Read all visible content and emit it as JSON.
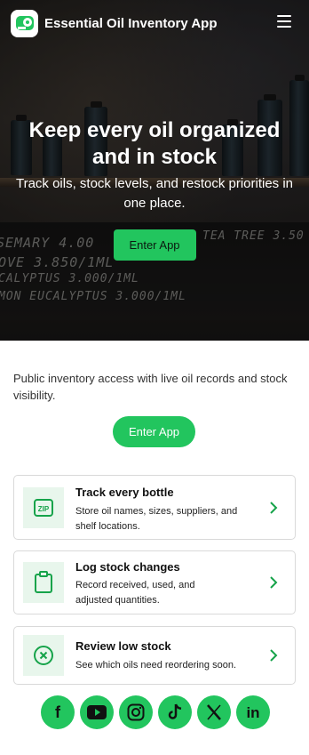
{
  "header": {
    "app_title": "Essential Oil Inventory App",
    "logo_icon": "roll-icon",
    "menu_icon": "hamburger-menu-icon"
  },
  "hero": {
    "title": "Keep every oil organized and in stock",
    "subtitle": "Track oils, stock levels, and restock priorities in one place.",
    "button_label": "Enter App",
    "background_chalk_text": [
      "SEMARY 4.00",
      "TEA TREE 3.50",
      "OVE 3.850/1ML",
      "CALYPTUS 3.000/1ML",
      "MON EUCALYPTUS 3.000/1ML"
    ]
  },
  "main": {
    "intro_text": "Public inventory access with live oil records and stock visibility.",
    "button_label": "Enter App"
  },
  "features": [
    {
      "title": "Track every bottle",
      "description": "Store oil names, sizes, suppliers, and shelf locations.",
      "icon": "zip-icon"
    },
    {
      "title": "Log stock changes",
      "description": "Record received, used, and adjusted quantities.",
      "icon": "clipboard-icon"
    },
    {
      "title": "Review low stock",
      "description": "See which oils need reordering soon.",
      "icon": "x-circle-icon"
    }
  ],
  "social": [
    {
      "name": "facebook-icon",
      "glyph": "f"
    },
    {
      "name": "youtube-icon",
      "glyph": ""
    },
    {
      "name": "instagram-icon",
      "glyph": ""
    },
    {
      "name": "tiktok-icon",
      "glyph": ""
    },
    {
      "name": "x-icon",
      "glyph": "X"
    },
    {
      "name": "linkedin-icon",
      "glyph": "in"
    }
  ],
  "colors": {
    "accent": "#22c55e",
    "icon_bg": "#e8f6ec",
    "hero_bg": "#1e1c1b"
  }
}
